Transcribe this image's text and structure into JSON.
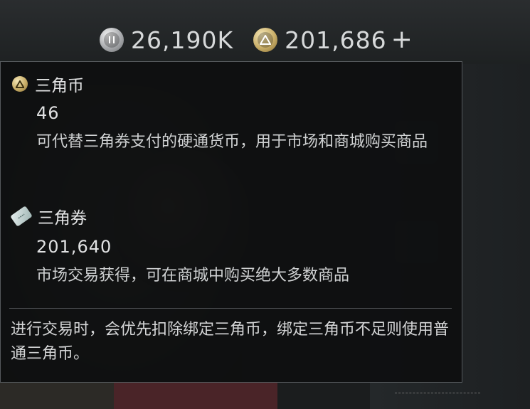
{
  "currency_bar": {
    "silver": {
      "icon": "silver-coin-icon",
      "value": "26,190K"
    },
    "gold": {
      "icon": "gold-triangle-coin-icon",
      "value": "201,686"
    },
    "add_label": "+"
  },
  "tooltip": {
    "coin": {
      "icon": "gold-triangle-coin-icon",
      "title": "三角币",
      "amount": "46",
      "description": "可代替三角券支付的硬通货币，用于市场和商城购买商品"
    },
    "ticket": {
      "icon": "ticket-icon",
      "title": "三角券",
      "amount": "201,640",
      "description": "市场交易获得，可在商城中购买绝大多数商品"
    },
    "note": "进行交易时，会优先扣除绑定三角币，绑定三角币不足则使用普通三角币。"
  },
  "colors": {
    "tooltip_bg": "#0e0f10",
    "tooltip_border": "#55595c",
    "text": "#d9dadb",
    "gold_coin": "#c9ae68",
    "silver_coin": "#a9abae"
  }
}
